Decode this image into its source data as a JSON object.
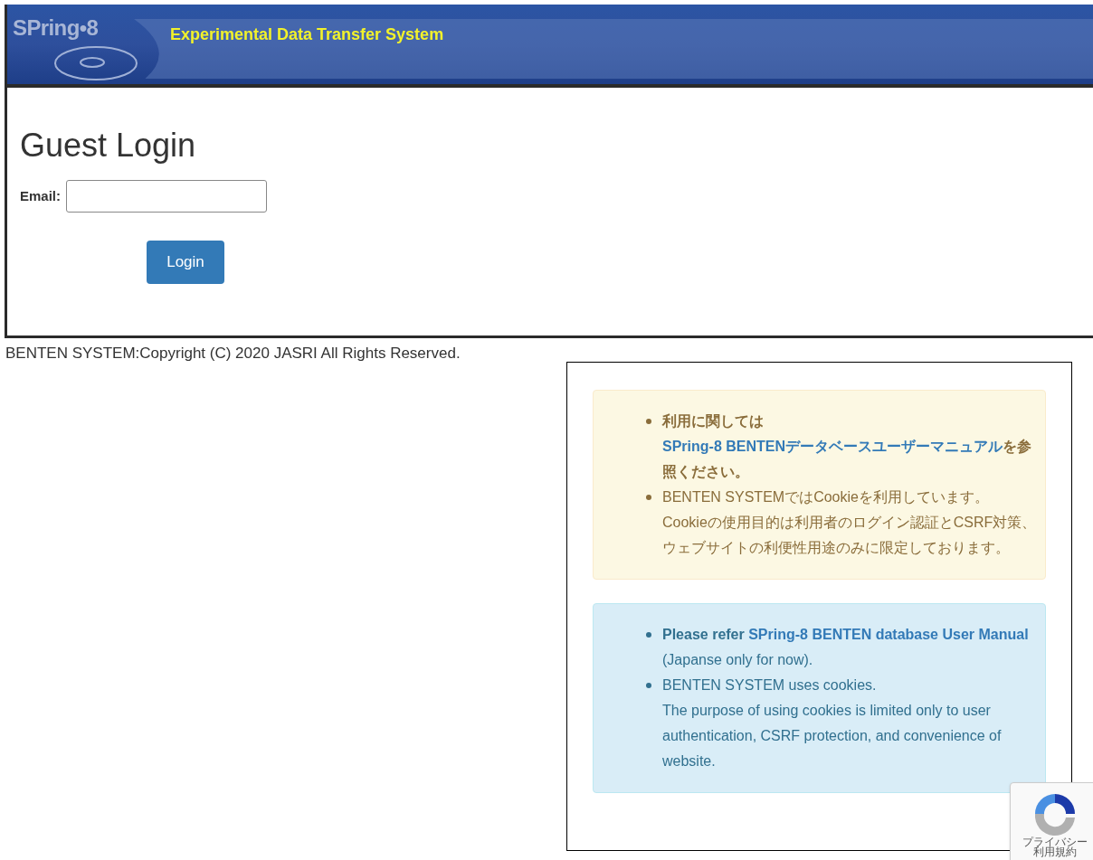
{
  "header": {
    "logo": "SPring•8",
    "title": "Experimental Data Transfer System"
  },
  "login": {
    "heading": "Guest Login",
    "email_label": "Email:",
    "button": "Login"
  },
  "footer": "BENTEN SYSTEM:Copyright (C) 2020 JASRI All Rights Reserved.",
  "notices": [
    {
      "kind": "warning",
      "items": [
        {
          "before": "**利用に関しては**",
          "link": "SPring-8 BENTENデータベースユーザーマニュアル",
          "after": "**を参照ください。**"
        },
        {
          "lines": [
            "BENTEN SYSTEMではCookieを利用しています。",
            "Cookieの使用目的は利用者のログイン認証とCSRF対策、ウェブサイトの利便性用途のみに限定しております。"
          ]
        }
      ]
    },
    {
      "kind": "info",
      "items": [
        {
          "before": "**Please refer** ",
          "link": "SPring-8 BENTEN database User Manual",
          "after": " (Japanse only for now)."
        },
        {
          "lines": [
            "BENTEN SYSTEM uses cookies.",
            "The purpose of using cookies is limited only to user authentication, CSRF protection, and convenience of website."
          ]
        }
      ]
    }
  ],
  "captcha": {
    "links": [
      "プライバシー",
      "利用規約"
    ]
  }
}
